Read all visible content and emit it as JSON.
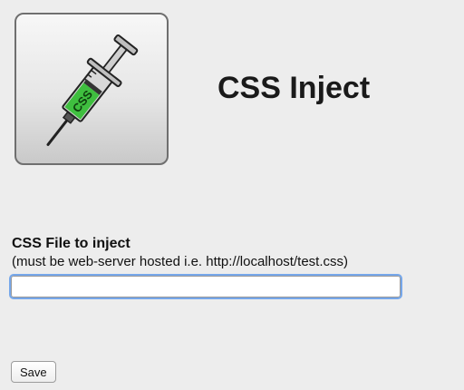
{
  "header": {
    "logo_icon": "syringe-icon",
    "logo_text": "CSS",
    "title": "CSS Inject"
  },
  "form": {
    "label": "CSS File to inject",
    "hint": "(must be web-server hosted i.e. http://localhost/test.css)",
    "input_value": "",
    "input_placeholder": "",
    "save_label": "Save"
  },
  "colors": {
    "background": "#ededed",
    "input_focus_ring": "#76a7ea",
    "syringe_liquid": "#3fbf3f"
  }
}
